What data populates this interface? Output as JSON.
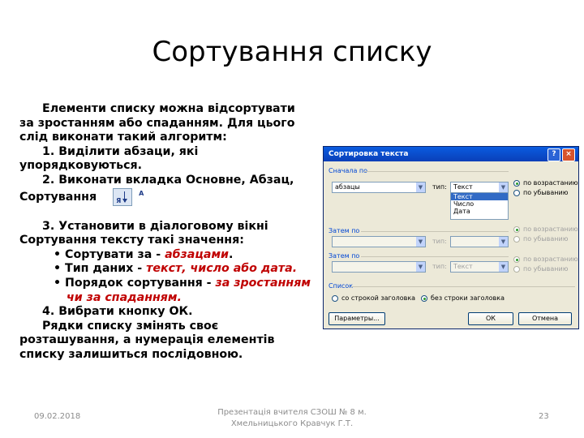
{
  "slide": {
    "title": "Сортування списку",
    "p1": "Елементи списку можна відсортувати за зростанням або спаданням. Для цього слід виконати такий алгоритм:",
    "step1": "1. Виділити абзаци, які упорядковуються.",
    "step2": "2. Виконати вкладка Основне, Абзац, Сортування",
    "step3": "3. Установити в діалоговому вікні Сортування тексту такі значення:",
    "b1_prefix": "Сортувати за - ",
    "b1_value": "абзацами",
    "b1_suffix": ".",
    "b2_prefix": "Тип даних - ",
    "b2_value": "текст, число або дата.",
    "b3_prefix": "Порядок сортування - ",
    "b3_value": "за зростанням чи за спаданням.",
    "step4": "4. Вибрати кнопку ОК.",
    "p_end": "Рядки списку змінять своє розташування, а нумерація елементів списку залишиться послідовною.",
    "bullet": "•",
    "sort_icon_letters": "АЯ"
  },
  "footer": {
    "date": "09.02.2018",
    "author_line1": "Презентація вчителя СЗОШ № 8 м.",
    "author_line2": "Хмельницького Кравчук Г.Т.",
    "page": "23"
  },
  "dialog": {
    "title": "Сортировка текста",
    "help": "?",
    "close": "×",
    "group1": "Сначала по",
    "field1": "абзацы",
    "type_label": "тип:",
    "type1": "Текст",
    "type_options": [
      "Текст",
      "Число",
      "Дата"
    ],
    "asc": "по возрастанию",
    "desc": "по убыванию",
    "group2": "Затем по",
    "group3": "Затем по",
    "type3": "Текст",
    "group4": "Список",
    "with_header": "со строкой заголовка",
    "no_header": "без строки заголовка",
    "params": "Параметры...",
    "ok": "ОК",
    "cancel": "Отмена",
    "dropdown_glyph": "▼"
  }
}
